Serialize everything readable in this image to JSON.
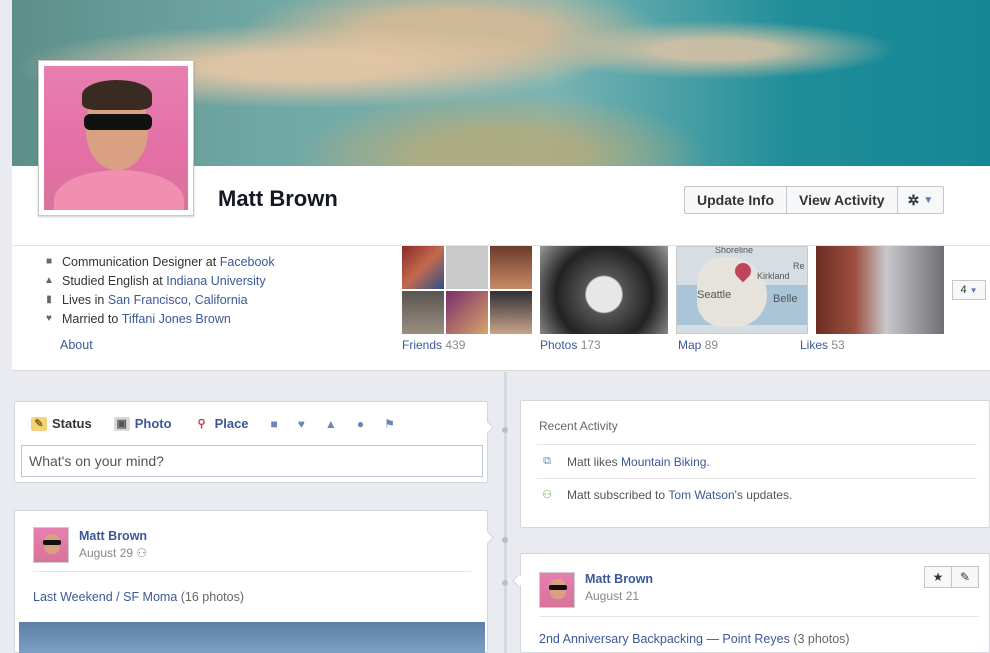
{
  "profile": {
    "name": "Matt Brown",
    "buttons": {
      "update_info": "Update Info",
      "view_activity": "View Activity"
    },
    "info": [
      {
        "icon": "briefcase-icon",
        "text": "Communication Designer at ",
        "link": "Facebook"
      },
      {
        "icon": "graduation-cap-icon",
        "text": "Studied English at ",
        "link": "Indiana University"
      },
      {
        "icon": "home-icon",
        "text": "Lives in ",
        "link": "San Francisco, California"
      },
      {
        "icon": "heart-icon",
        "text": "Married to ",
        "link": "Tiffani Jones Brown"
      }
    ],
    "about_label": "About"
  },
  "tiles": {
    "friends": {
      "label": "Friends",
      "count": "439"
    },
    "photos": {
      "label": "Photos",
      "count": "173"
    },
    "map": {
      "label": "Map",
      "count": "89",
      "places": [
        "Shoreline",
        "Seattle",
        "Belle",
        "Kirkland",
        "Re"
      ]
    },
    "likes": {
      "label": "Likes",
      "count": "53"
    },
    "more": "4"
  },
  "composer": {
    "tabs": [
      "Status",
      "Photo",
      "Place"
    ],
    "placeholder": "What's on your mind?"
  },
  "recent_activity": {
    "title": "Recent Activity",
    "items": [
      {
        "prefix": "Matt likes ",
        "link": "Mountain Biking",
        "suffix": "."
      },
      {
        "prefix": "Matt subscribed to ",
        "link": "Tom Watson",
        "suffix": "'s updates."
      }
    ]
  },
  "posts": [
    {
      "author": "Matt Brown",
      "date": "August 29",
      "title": "Last Weekend / SF Moma",
      "meta": "(16 photos)"
    },
    {
      "author": "Matt Brown",
      "date": "August 21",
      "title": "2nd Anniversary Backpacking — Point Reyes",
      "meta": "(3 photos)"
    }
  ],
  "colors": {
    "link": "#3b5998",
    "background": "#e9ebf0",
    "cover_water": "#148796"
  }
}
